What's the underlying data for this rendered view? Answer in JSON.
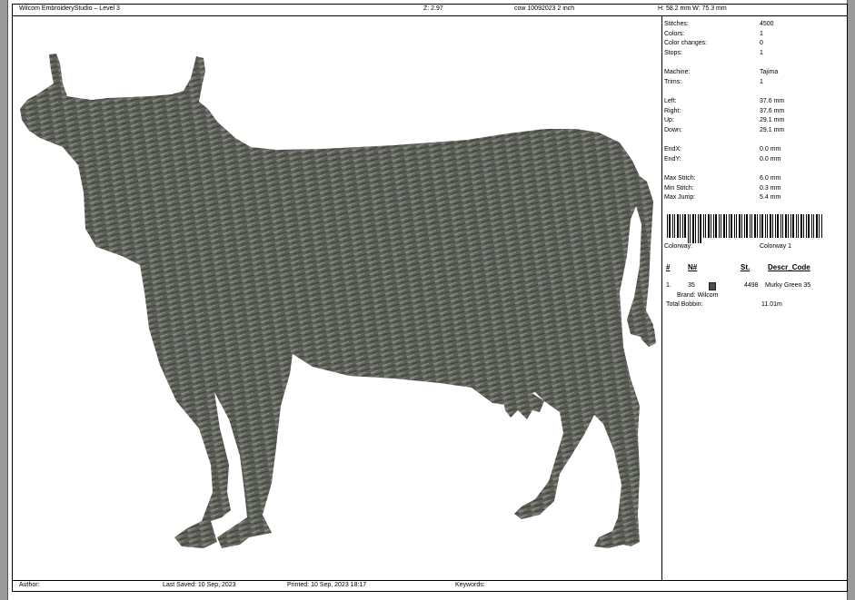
{
  "header": {
    "app_title": "Wilcom EmbroideryStudio – Level 3",
    "zoom": "Z: 2.97",
    "design_name": "cow 10092023 2 inch",
    "size": "H: 58.2 mm   W: 75.3 mm"
  },
  "stats": {
    "stitches": {
      "label": "Stitches:",
      "value": "4500"
    },
    "colors": {
      "label": "Colors:",
      "value": "1"
    },
    "color_changes": {
      "label": "Color changes:",
      "value": "0"
    },
    "stops": {
      "label": "Stops:",
      "value": "1"
    },
    "machine": {
      "label": "Machine:",
      "value": "Tajima"
    },
    "trims": {
      "label": "Trims:",
      "value": "1"
    },
    "left": {
      "label": "Left:",
      "value": "37.6 mm"
    },
    "right": {
      "label": "Right:",
      "value": "37.6 mm"
    },
    "up": {
      "label": "Up:",
      "value": "29.1 mm"
    },
    "down": {
      "label": "Down:",
      "value": "29.1 mm"
    },
    "endx": {
      "label": "EndX:",
      "value": "0.0 mm"
    },
    "endy": {
      "label": "EndY:",
      "value": "0.0 mm"
    },
    "max_stitch": {
      "label": "Max Stitch:",
      "value": "6.0 mm"
    },
    "min_stitch": {
      "label": "Min Stitch:",
      "value": "0.3 mm"
    },
    "max_jump": {
      "label": "Max Jump:",
      "value": "5.4 mm"
    }
  },
  "colorway": {
    "label": "Colorway:",
    "value": "Colorway 1"
  },
  "color_table": {
    "headers": {
      "index": "#",
      "number": "N#",
      "stitches": "St.",
      "descr": "Descr_Code"
    },
    "rows": [
      {
        "index": "1.",
        "number": "35",
        "swatch_color": "#4a4f47",
        "stitches": "4498",
        "descr": "Murky Green 35",
        "brand": "Brand: Wilcom"
      }
    ],
    "total_bobbin_label": "Total Bobbin:",
    "total_bobbin_value": "11.01m"
  },
  "footer": {
    "author_label": "Author:",
    "last_saved": "Last Saved: 10 Sep, 2023",
    "printed": "Printed: 10 Sep, 2023 18:17",
    "keywords_label": "Keywords:"
  },
  "design": {
    "thread_color": "#5c6058",
    "thread_dark": "#3d403a",
    "thread_light": "#8a8e85"
  }
}
